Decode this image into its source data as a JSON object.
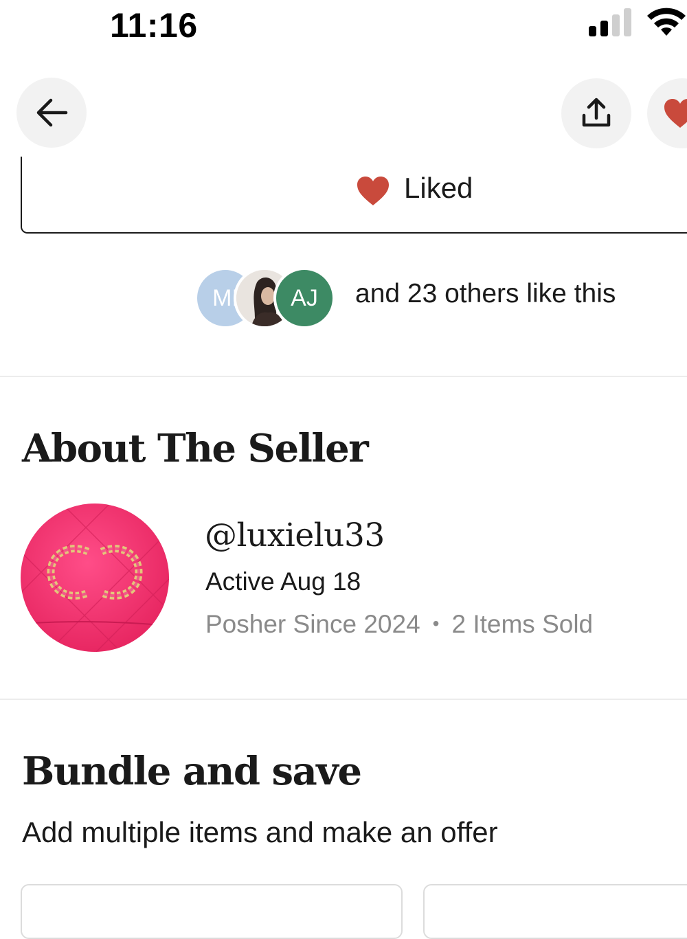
{
  "status_bar": {
    "time": "11:16",
    "signal_icon": "cellular-signal-icon",
    "wifi_icon": "wifi-icon"
  },
  "top_nav": {
    "back_icon": "arrow-left-icon",
    "share_icon": "share-upload-icon",
    "like_icon": "heart-icon"
  },
  "like_button": {
    "label": "Liked",
    "heart_color": "#c94a3c"
  },
  "likers": {
    "avatars": [
      {
        "initials": "MI",
        "color": "#b8cfe8"
      },
      {
        "initials": "",
        "color": "#e9e4df"
      },
      {
        "initials": "AJ",
        "color": "#3d8a64"
      }
    ],
    "text": "and 23 others like this"
  },
  "about_seller": {
    "heading": "About The Seller",
    "handle": "@luxielu33",
    "active": "Active Aug 18",
    "since": "Posher Since 2024",
    "separator": "•",
    "items_sold": "2 Items Sold",
    "avatar_color": "#f0336f"
  },
  "bundle": {
    "heading": "Bundle and save",
    "subtitle": "Add multiple items and make an offer"
  }
}
